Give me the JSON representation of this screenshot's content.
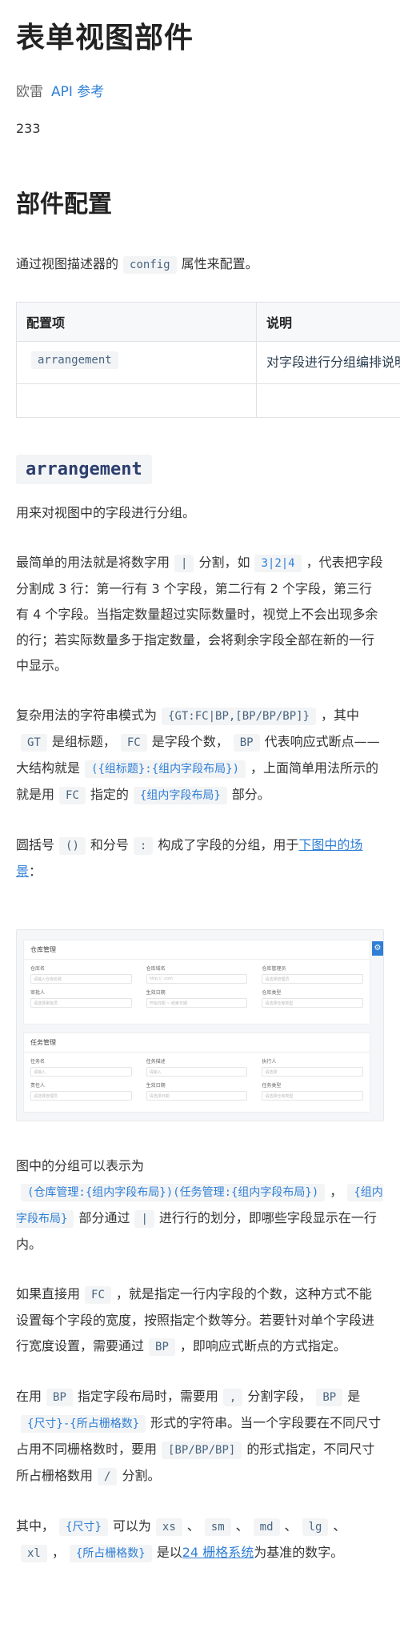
{
  "title": "表单视图部件",
  "meta": {
    "author": "欧雷",
    "api_link": "API 参考"
  },
  "number": "233",
  "section_title": "部件配置",
  "config_intro": {
    "before": "通过视图描述器的",
    "code": "config",
    "after": "属性来配置。"
  },
  "table": {
    "headers": [
      "配置项",
      "说明"
    ],
    "rows": [
      {
        "key": "arrangement",
        "desc": "对字段进行分组编排说明"
      },
      {
        "key": "",
        "desc": ""
      }
    ]
  },
  "arrangement_heading": "arrangement",
  "para1": "用来对视图中的字段进行分组。",
  "para2": {
    "a": "最简单的用法就是将数字用",
    "code1": "|",
    "b": "分割，如",
    "code2": "3|2|4",
    "c": "，代表把字段分割成 3 行：第一行有 3 个字段，第二行有 2 个字段，第三行有 4 个字段。当指定数量超过实际数量时，视觉上不会出现多余的行；若实际数量多于指定数量，会将剩余字段全部在新的一行中显示。"
  },
  "para3": {
    "a": "复杂用法的字符串模式为",
    "code1": "{GT:FC|BP,[BP/BP/BP]}",
    "b": "，其中",
    "code2": "GT",
    "c": "是组标题，",
    "code3": "FC",
    "d": "是字段个数，",
    "code4": "BP",
    "e": "代表响应式断点——大结构就是",
    "code5": "({组标题}:{组内字段布局})",
    "f": "，上面简单用法所示的就是用",
    "code6": "FC",
    "g": "指定的",
    "code7": "{组内字段布局}",
    "h": "部分。"
  },
  "para4": {
    "a": "圆括号",
    "code1": "()",
    "b": "和分号",
    "code2": ":",
    "c": "构成了字段的分组，用于",
    "link": "下图中的场景",
    "d": "："
  },
  "figure": {
    "panel1": {
      "title": "仓库管理",
      "fields": [
        {
          "label": "仓库名",
          "ph": "请输入仓库名称"
        },
        {
          "label": "仓库域名",
          "ph": "http://    .com"
        },
        {
          "label": "仓库管理员",
          "ph": "请选择管理员"
        },
        {
          "label": "审批人",
          "ph": "请选择审批员"
        },
        {
          "label": "生效日期",
          "ph": "开始日期 ~ 结束日期"
        },
        {
          "label": "仓库类型",
          "ph": "请选择仓库类型"
        }
      ]
    },
    "panel2": {
      "title": "任务管理",
      "fields": [
        {
          "label": "任务名",
          "ph": "请输入"
        },
        {
          "label": "任务描述",
          "ph": "请输入"
        },
        {
          "label": "执行人",
          "ph": "请选择"
        },
        {
          "label": "责任人",
          "ph": "请选择管理员"
        },
        {
          "label": "生效日期",
          "ph": "请选择日期"
        },
        {
          "label": "任务类型",
          "ph": "请选择仓库类型"
        }
      ]
    }
  },
  "para5": {
    "a": "图中的分组可以表示为",
    "code1": "(仓库管理:{组内字段布局})(任务管理:{组内字段布局})",
    "b": "，",
    "code2": "{组内字段布局}",
    "c": "部分通过",
    "code3": "|",
    "d": "进行行的划分，即哪些字段显示在一行内。"
  },
  "para6": {
    "a": "如果直接用",
    "code1": "FC",
    "b": "，就是指定一行内字段的个数，这种方式不能设置每个字段的宽度，按照指定个数等分。若要针对单个字段进行宽度设置，需要通过",
    "code2": "BP",
    "c": "，即响应式断点的方式指定。"
  },
  "para7": {
    "a": "在用",
    "code1": "BP",
    "b": "指定字段布局时，需要用",
    "code2": ",",
    "c": "分割字段，",
    "code3": "BP",
    "d": "是",
    "code4": "{尺寸}-{所占栅格数}",
    "e": "形式的字符串。当一个字段要在不同尺寸占用不同栅格数时，要用",
    "code5": "[BP/BP/BP]",
    "f": "的形式指定，不同尺寸所占栅格数用",
    "code6": "/",
    "g": "分割。"
  },
  "para8": {
    "a": "其中，",
    "code1": "{尺寸}",
    "b": "可以为",
    "code2": "xs",
    "sep1": "、",
    "code3": "sm",
    "sep2": "、",
    "code4": "md",
    "sep3": "、",
    "code5": "lg",
    "sep4": "、",
    "code6": "xl",
    "c": "，",
    "code7": "{所占栅格数}",
    "d": "是以",
    "link": "24 栅格系统",
    "e": "为基准的数字。"
  }
}
